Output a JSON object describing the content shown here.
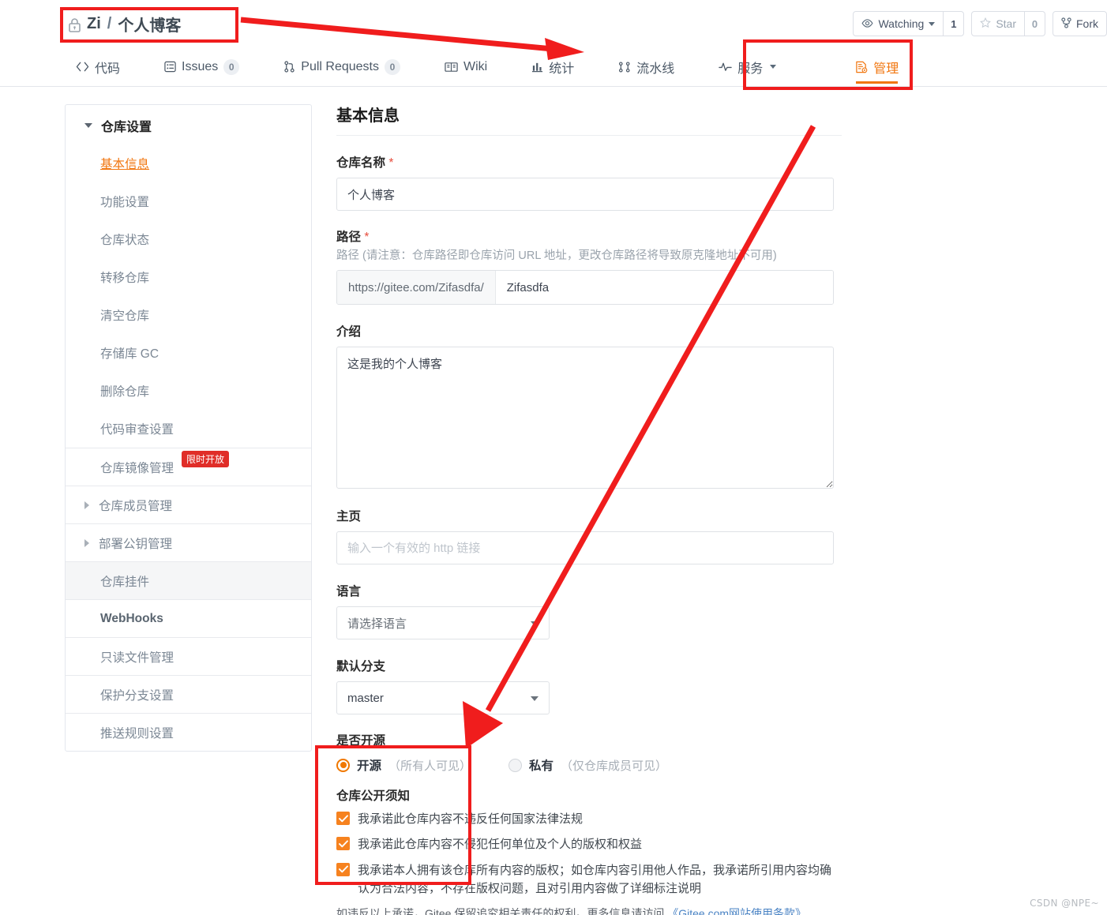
{
  "header": {
    "repo_owner": "Zi",
    "separator": "/",
    "repo_name": "个人博客",
    "lock_icon": "lock-icon",
    "actions": {
      "watching_label": "Watching",
      "watching_count": "1",
      "star_label": "Star",
      "star_count": "0",
      "fork_label": "Fork"
    }
  },
  "nav": {
    "items": [
      {
        "label": "代码",
        "icon": "code-icon",
        "badge": "",
        "active": false
      },
      {
        "label": "Issues",
        "icon": "issue-icon",
        "badge": "0",
        "active": false
      },
      {
        "label": "Pull Requests",
        "icon": "pull-request-icon",
        "badge": "0",
        "active": false
      },
      {
        "label": "Wiki",
        "icon": "book-icon",
        "badge": "",
        "active": false
      },
      {
        "label": "统计",
        "icon": "chart-icon",
        "badge": "",
        "active": false
      },
      {
        "label": "流水线",
        "icon": "pipeline-icon",
        "badge": "",
        "active": false
      },
      {
        "label": "服务",
        "icon": "pulse-icon",
        "badge": "",
        "active": false
      },
      {
        "label": "管理",
        "icon": "settings-doc-icon",
        "badge": "",
        "active": true
      }
    ]
  },
  "sidebar": {
    "group_title": "仓库设置",
    "items": [
      {
        "label": "基本信息",
        "state": "active"
      },
      {
        "label": "功能设置",
        "state": "normal"
      },
      {
        "label": "仓库状态",
        "state": "normal"
      },
      {
        "label": "转移仓库",
        "state": "normal"
      },
      {
        "label": "清空仓库",
        "state": "normal"
      },
      {
        "label": "存储库 GC",
        "state": "normal"
      },
      {
        "label": "删除仓库",
        "state": "normal"
      },
      {
        "label": "代码审查设置",
        "state": "normal"
      },
      {
        "label": "仓库镜像管理",
        "state": "normal",
        "badge": "限时开放",
        "divider": true
      },
      {
        "label": "仓库成员管理",
        "state": "expandable",
        "divider": true
      },
      {
        "label": "部署公钥管理",
        "state": "expandable",
        "divider": true
      },
      {
        "label": "仓库挂件",
        "state": "selected",
        "divider": true
      },
      {
        "label": "WebHooks",
        "state": "bold",
        "divider": true
      },
      {
        "label": "只读文件管理",
        "state": "normal",
        "divider": true
      },
      {
        "label": "保护分支设置",
        "state": "normal",
        "divider": true
      },
      {
        "label": "推送规则设置",
        "state": "normal",
        "divider": true
      }
    ]
  },
  "main": {
    "page_title": "基本信息",
    "repo_name_label": "仓库名称",
    "repo_name_required": "*",
    "repo_name_value": "个人博客",
    "path_label": "路径",
    "path_required": "*",
    "path_hint": "路径 (请注意：仓库路径即仓库访问 URL 地址，更改仓库路径将导致原克隆地址不可用)",
    "path_prefix": "https://gitee.com/Zifasdfa/",
    "path_value": "Zifasdfa",
    "intro_label": "介绍",
    "intro_value": "这是我的个人博客",
    "homepage_label": "主页",
    "homepage_placeholder": "输入一个有效的 http 链接",
    "homepage_value": "",
    "language_label": "语言",
    "language_value": "请选择语言",
    "branch_label": "默认分支",
    "branch_value": "master",
    "opensource_label": "是否开源",
    "radio_public_name": "开源",
    "radio_public_desc": "（所有人可见）",
    "radio_private_name": "私有",
    "radio_private_desc": "（仅仓库成员可见）",
    "notice_title": "仓库公开须知",
    "notice_items": [
      "我承诺此仓库内容不违反任何国家法律法规",
      "我承诺此仓库内容不侵犯任何单位及个人的版权和权益",
      "我承诺本人拥有该仓库所有内容的版权；如仓库内容引用他人作品，我承诺所引用内容均确认为合法内容，不存在版权问题，且对引用内容做了详细标注说明"
    ],
    "terms_prefix": "如违反以上承诺，Gitee 保留追究相关责任的权利。更多信息请访问 ",
    "terms_link": "《Gitee.com网站使用条款》"
  },
  "annotations": {
    "color": "#f01d1d",
    "boxes": [
      "repo-title-box",
      "manage-tab-box",
      "opensource-box"
    ],
    "arrows": [
      "arrow-to-manage-tab",
      "arrow-to-opensource"
    ]
  },
  "watermark": "CSDN @NPE~",
  "colors": {
    "accent": "#f1760f",
    "annotation_red": "#f01d1d",
    "badge_red": "#e02d28",
    "checkbox_orange": "#f6821f",
    "link_blue": "#4a83c4"
  }
}
